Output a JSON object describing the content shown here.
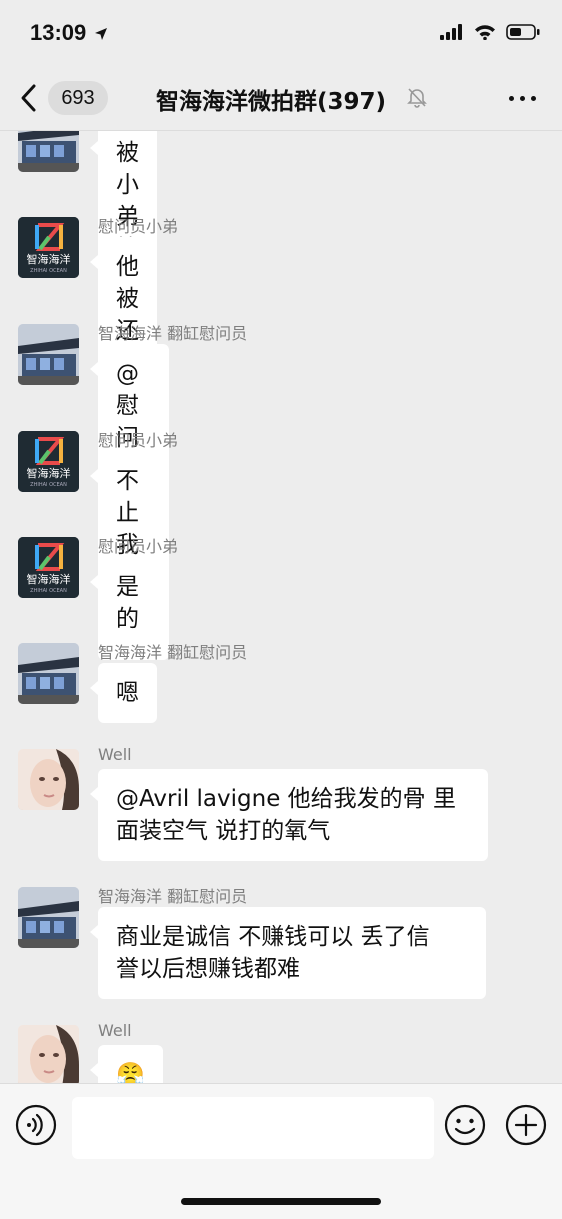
{
  "status": {
    "time": "13:09"
  },
  "nav": {
    "back_count": "693",
    "title": "智海海洋微拍群(397)"
  },
  "messages": [
    {
      "sender": "",
      "text": "被小弟拉黑了",
      "avatar": "bus"
    },
    {
      "sender": "慰问员小弟",
      "text": "他被还几个商家拉黑了",
      "avatar": "logo"
    },
    {
      "sender": "智海海洋 翻缸慰问员",
      "text": "@慰问员小弟 是不是?",
      "avatar": "bus"
    },
    {
      "sender": "慰问员小弟",
      "text": "不止我们",
      "avatar": "logo"
    },
    {
      "sender": "慰问员小弟",
      "text": "是的",
      "avatar": "logo"
    },
    {
      "sender": "智海海洋 翻缸慰问员",
      "text": "嗯",
      "avatar": "bus"
    },
    {
      "sender": "Well",
      "text_line1": "@Avril lavigne 他给我发的骨 里",
      "text_line2": "面装空气 说打的氧气",
      "avatar": "face"
    },
    {
      "sender": "智海海洋 翻缸慰问员",
      "text_line1": "商业是诚信 不赚钱可以 丢了信",
      "text_line2": "誉以后想赚钱都难",
      "avatar": "bus"
    },
    {
      "sender": "Well",
      "text": "😤",
      "avatar": "face"
    }
  ],
  "logo": {
    "line1": "智海海洋",
    "line2": "ZHIHAI OCEAN"
  }
}
